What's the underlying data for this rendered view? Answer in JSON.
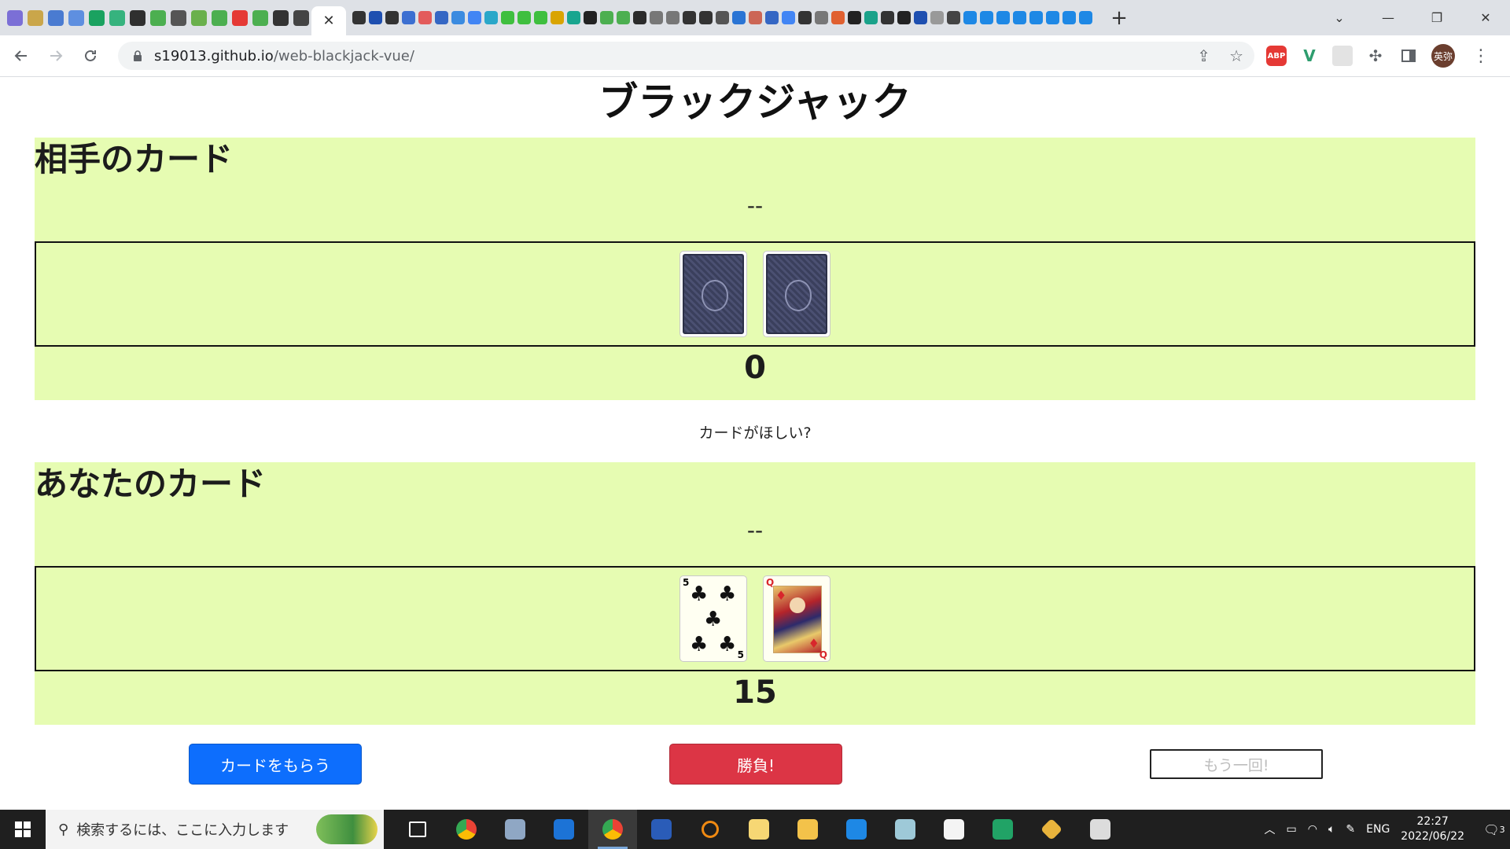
{
  "browser": {
    "active_tab_close": "✕",
    "new_tab": "+",
    "url_host": "s19013.github.io",
    "url_path": "/web-blackjack-vue/",
    "window_controls": [
      "⌄",
      "—",
      "❐",
      "✕"
    ],
    "extensions": [
      {
        "name": "adblock-plus",
        "label": "ABP",
        "color": "#e53935"
      },
      {
        "name": "vue-devtools",
        "label": "V",
        "color": "#2e9d6e"
      },
      {
        "name": "extension-placeholder",
        "label": "",
        "color": "#d7d7d7"
      }
    ],
    "profile_label": "英弥"
  },
  "page": {
    "title": "ブラックジャック",
    "prompt": "カードがほしい?",
    "dealer": {
      "heading": "相手のカード",
      "status": "--",
      "total": "0",
      "cards": [
        {
          "face": "back"
        },
        {
          "face": "back"
        }
      ]
    },
    "player": {
      "heading": "あなたのカード",
      "status": "--",
      "total": "15",
      "cards": [
        {
          "face": "front",
          "rank": "5",
          "suit": "♣",
          "suit_color": "#111111"
        },
        {
          "face": "front",
          "rank": "Q",
          "suit": "♦",
          "suit_color": "#d8262c"
        }
      ]
    },
    "buttons": {
      "draw": "カードをもらう",
      "fight": "勝負!",
      "again": "もう一回!"
    }
  },
  "taskbar": {
    "search_placeholder": "検索するには、ここに入力します",
    "tray_language": "ENG",
    "clock_time": "22:27",
    "clock_date": "2022/06/22",
    "notification_count": "3"
  }
}
